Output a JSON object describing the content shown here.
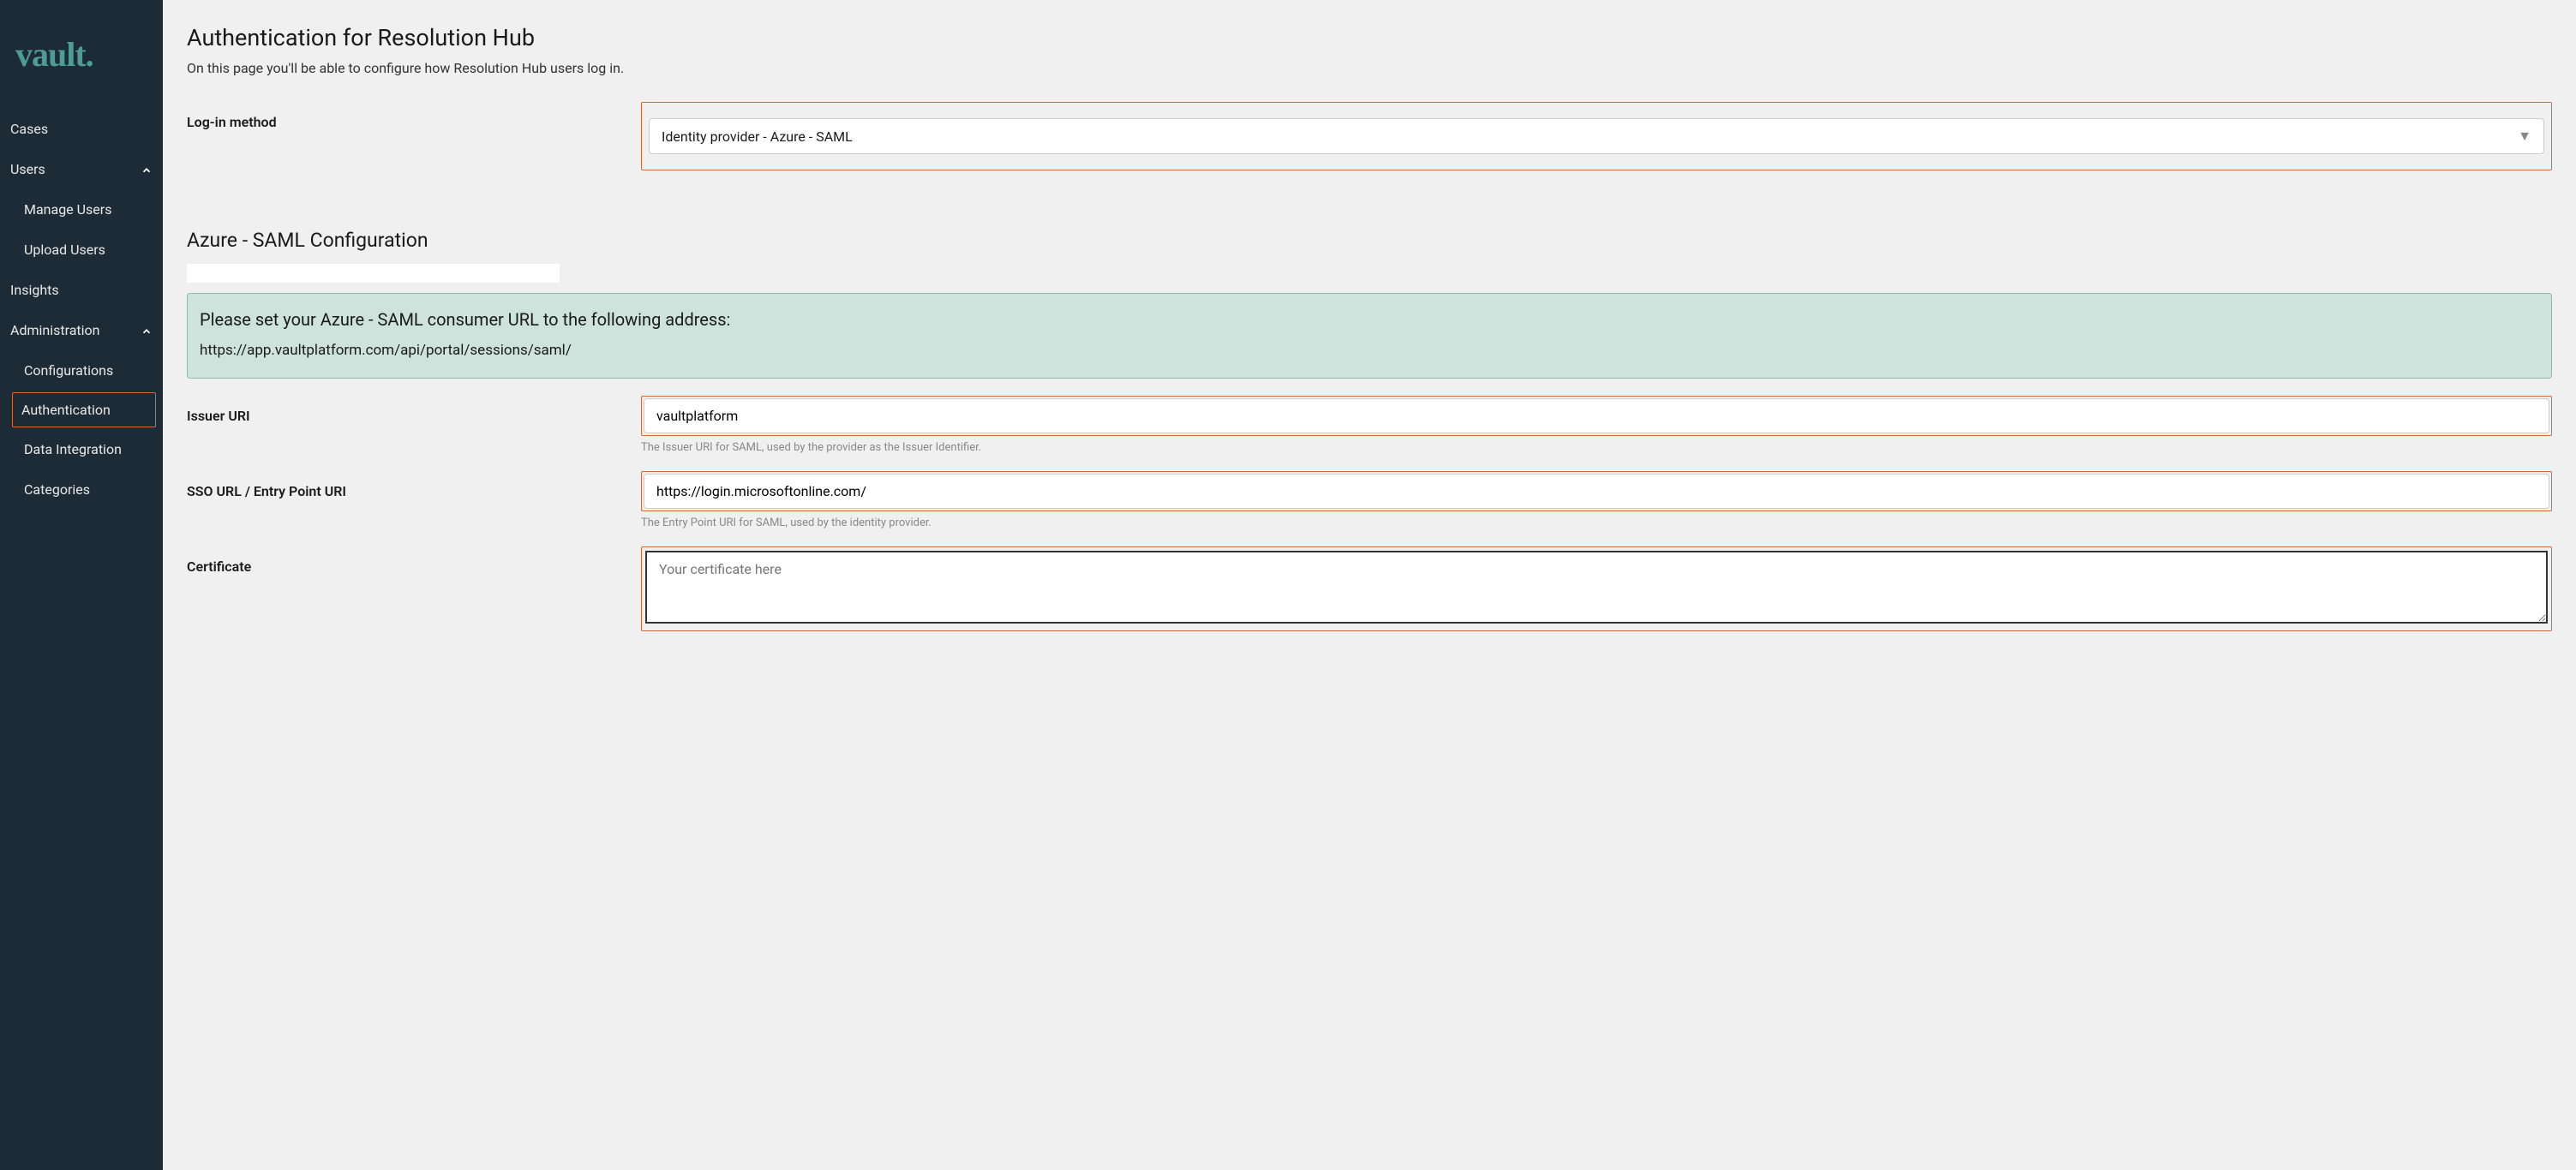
{
  "logo": "vault.",
  "sidebar": {
    "items": [
      {
        "label": "Cases"
      },
      {
        "label": "Users",
        "expanded": true,
        "children": [
          {
            "label": "Manage Users"
          },
          {
            "label": "Upload Users"
          }
        ]
      },
      {
        "label": "Insights"
      },
      {
        "label": "Administration",
        "expanded": true,
        "children": [
          {
            "label": "Configurations"
          },
          {
            "label": "Authentication",
            "active": true
          },
          {
            "label": "Data Integration"
          },
          {
            "label": "Categories"
          }
        ]
      }
    ]
  },
  "page": {
    "title": "Authentication for Resolution Hub",
    "description": "On this page you'll be able to configure how Resolution Hub users log in."
  },
  "form": {
    "login_method_label": "Log-in method",
    "login_method_value": "Identity provider - Azure - SAML",
    "section_title": "Azure - SAML Configuration",
    "banner_title": "Please set your Azure - SAML consumer URL to the following address:",
    "banner_url": "https://app.vaultplatform.com/api/portal/sessions/saml/",
    "issuer_label": "Issuer URI",
    "issuer_value": "vaultplatform",
    "issuer_help": "The Issuer URI for SAML, used by the provider as the Issuer Identifier.",
    "sso_label": "SSO URL / Entry Point URI",
    "sso_value": "https://login.microsoftonline.com/",
    "sso_help": "The Entry Point URI for SAML, used by the identity provider.",
    "cert_label": "Certificate",
    "cert_placeholder": "Your certificate here"
  }
}
